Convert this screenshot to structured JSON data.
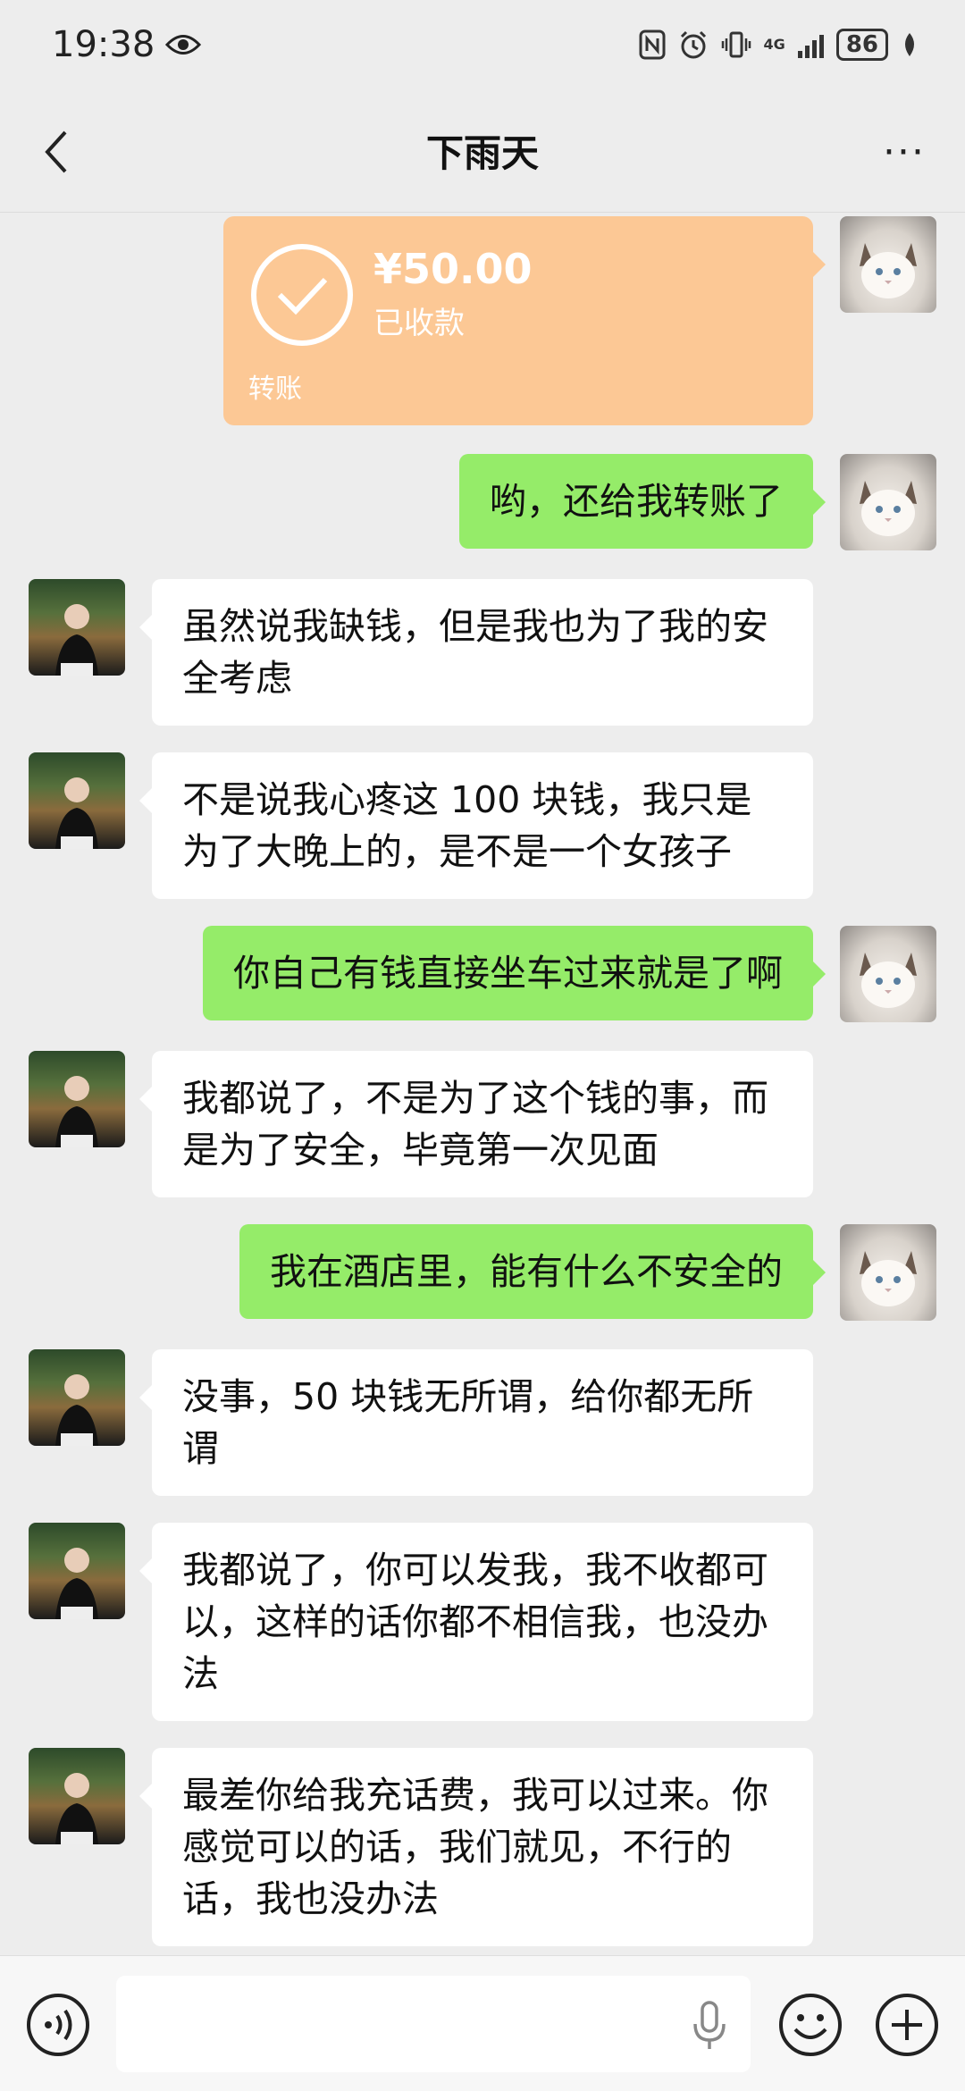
{
  "status_bar": {
    "time": "19:38",
    "network": "4G",
    "battery": "86"
  },
  "nav": {
    "title": "下雨天",
    "more_label": "···"
  },
  "transfer": {
    "amount": "¥50.00",
    "status": "已收款",
    "label": "转账"
  },
  "messages": [
    {
      "side": "out",
      "text": "哟，还给我转账了"
    },
    {
      "side": "in",
      "text": "虽然说我缺钱，但是我也为了我的安全考虑"
    },
    {
      "side": "in",
      "text": "不是说我心疼这 100 块钱，我只是为了大晚上的，是不是一个女孩子"
    },
    {
      "side": "out",
      "text": "你自己有钱直接坐车过来就是了啊"
    },
    {
      "side": "in",
      "text": "我都说了，不是为了这个钱的事，而是为了安全，毕竟第一次见面"
    },
    {
      "side": "out",
      "text": "我在酒店里，能有什么不安全的"
    },
    {
      "side": "in",
      "text": "没事，50 块钱无所谓，给你都无所谓"
    },
    {
      "side": "in",
      "text": "我都说了，你可以发我，我不收都可以，这样的话你都不相信我，也没办法"
    },
    {
      "side": "in",
      "text": "最差你给我充话费，我可以过来。你感觉可以的话，我们就见，不行的话，我也没办法"
    }
  ],
  "input": {
    "value": ""
  },
  "colors": {
    "background": "#ededed",
    "outgoing_bubble": "#95ec69",
    "incoming_bubble": "#ffffff",
    "transfer_card": "#fcc895"
  }
}
